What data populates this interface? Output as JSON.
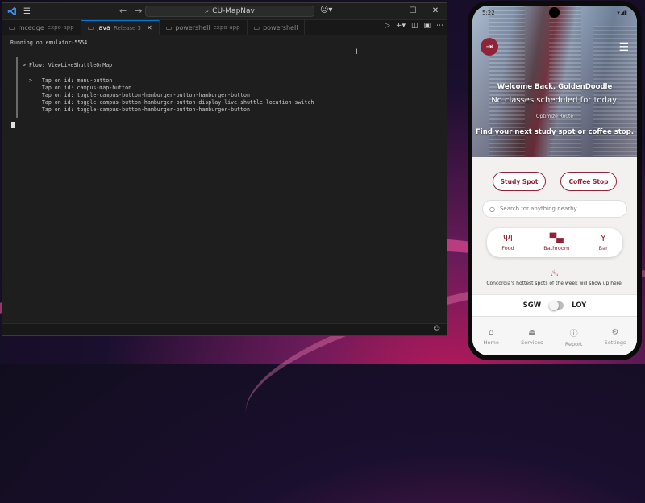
{
  "vscode": {
    "titlebar": {
      "app_icon": "vscode-logo-icon",
      "command_center_text": "CU-MapNav"
    },
    "tabs": [
      {
        "label": "mcedge",
        "description": "expo-app",
        "icon": "terminal-icon",
        "active": false
      },
      {
        "label": "java",
        "description": "Release 3",
        "icon": "terminal-icon",
        "active": true
      },
      {
        "label": "powershell",
        "description": "expo-app",
        "icon": "terminal-icon",
        "active": false
      },
      {
        "label": "powershell",
        "description": "",
        "icon": "terminal-icon",
        "active": false
      }
    ],
    "terminal": {
      "running": "Running on emulator-5554",
      "flow": "> Flow: ViewLiveShuttleOnMap",
      "steps": [
        ">   Tap on id: menu-button",
        "    Tap on id: campus-map-button",
        "    Tap on id: toggle-campus-button-hamburger-button-hamburger-button",
        "    Tap on id: toggle-campus-button-hamburger-button-display-live-shuttle-location-switch",
        "    Tap on id: toggle-campus-button-hamburger-button-hamburger-button"
      ]
    }
  },
  "phone": {
    "status_time": "5:22",
    "hero": {
      "welcome": "Welcome Back, GoldenDoodle",
      "no_classes": "No classes scheduled for today.",
      "optimize": "Optimize Route",
      "find_next": "Find your next study spot or coffee stop."
    },
    "buttons": {
      "study": "Study Spot",
      "coffee": "Coffee Stop"
    },
    "search_placeholder": "Search for anything nearby",
    "categories": [
      {
        "label": "Food",
        "icon": "fork-knife-icon"
      },
      {
        "label": "Bathroom",
        "icon": "toilet-icon"
      },
      {
        "label": "Bar",
        "icon": "cocktail-icon"
      }
    ],
    "hottest_text": "Concordia's hottest spots of the week will show up here.",
    "campus_toggle": {
      "left": "SGW",
      "right": "LOY"
    },
    "nav": [
      {
        "label": "Home",
        "icon": "home-icon"
      },
      {
        "label": "Services",
        "icon": "services-icon"
      },
      {
        "label": "Report",
        "icon": "report-icon"
      },
      {
        "label": "Settings",
        "icon": "settings-icon"
      }
    ],
    "colors": {
      "accent": "#912338"
    }
  }
}
